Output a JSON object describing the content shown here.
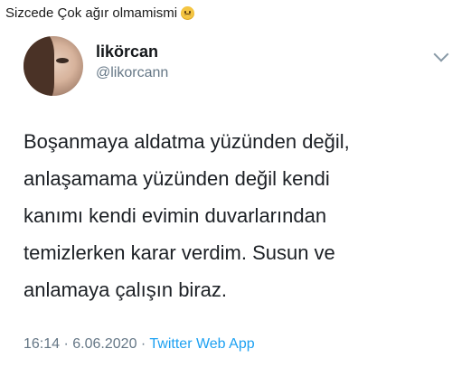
{
  "caption": {
    "text": "Sizcede Çok ağır olmamismi",
    "emoji": "worried-face-emoji"
  },
  "tweet": {
    "display_name": "likörcan",
    "handle": "@likorcann",
    "lines": [
      "Boşanmaya aldatma yüzünden değil,",
      "anlaşamama yüzünden değil kendi",
      "kanımı kendi evimin duvarlarından",
      "temizlerken karar verdim. Susun ve",
      "anlamaya çalışın biraz."
    ],
    "time": "16:14",
    "separator": "·",
    "date": "6.06.2020",
    "source_app": "Twitter Web App"
  },
  "colors": {
    "text": "#14171a",
    "secondary": "#657786",
    "link": "#1da1f2"
  },
  "icons": {
    "more": "chevron-down-icon"
  }
}
